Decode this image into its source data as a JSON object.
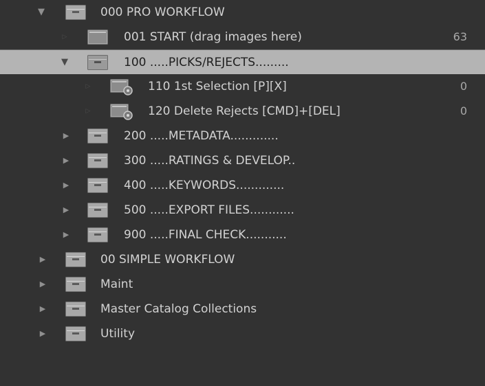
{
  "collections": {
    "pro_workflow": {
      "label": "000 PRO WORKFLOW",
      "state": "expanded"
    },
    "start": {
      "label": "001 START (drag images here)",
      "count": "63"
    },
    "picks_rejects": {
      "label": "100 .....PICKS/REJECTS.........",
      "state": "expanded",
      "selected": true
    },
    "first_selection": {
      "label": "110 1st Selection [P][X]",
      "count": "0"
    },
    "delete_rejects": {
      "label": "120  Delete Rejects [CMD]+[DEL]",
      "count": "0"
    },
    "metadata": {
      "label": "200 .....METADATA.............",
      "state": "collapsed"
    },
    "ratings_develop": {
      "label": "300 .....RATINGS & DEVELOP..",
      "state": "collapsed"
    },
    "keywords": {
      "label": "400 .....KEYWORDS.............",
      "state": "collapsed"
    },
    "export_files": {
      "label": "500 .....EXPORT FILES............",
      "state": "collapsed"
    },
    "final_check": {
      "label": "900 .....FINAL CHECK...........",
      "state": "collapsed"
    },
    "simple_workflow": {
      "label": "00 SIMPLE WORKFLOW",
      "state": "collapsed"
    },
    "maint": {
      "label": "Maint",
      "state": "collapsed"
    },
    "master_catalog": {
      "label": "Master Catalog Collections",
      "state": "collapsed"
    },
    "utility": {
      "label": "Utility",
      "state": "collapsed"
    }
  },
  "icons": {
    "collection_set": "collection-set-icon",
    "collection": "collection-icon",
    "smart_collection": "smart-collection-icon",
    "expand": "disclosure-triangle-down-icon",
    "collapse": "disclosure-triangle-right-icon"
  },
  "colors": {
    "panel_background": "#323232",
    "selected_row": "#b4b4b4",
    "text": "#d2d2d2",
    "selected_text": "#1e1e1e",
    "count_text": "#a9a9a9"
  }
}
